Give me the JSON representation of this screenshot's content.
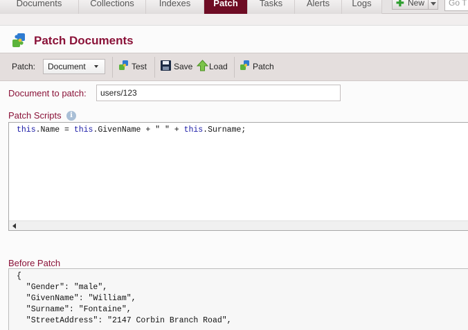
{
  "nav": {
    "tabs": [
      {
        "label": "Documents"
      },
      {
        "label": "Collections"
      },
      {
        "label": "Indexes"
      },
      {
        "label": "Patch"
      },
      {
        "label": "Tasks"
      },
      {
        "label": "Alerts"
      },
      {
        "label": "Logs"
      }
    ],
    "active_tab": "Patch",
    "new_button": "New",
    "goto_placeholder": "Go T"
  },
  "page": {
    "title": "Patch Documents"
  },
  "toolbar": {
    "patch_label": "Patch:",
    "patch_type": "Document",
    "test_label": "Test",
    "save_label": "Save",
    "load_label": "Load",
    "patch_button_label": "Patch"
  },
  "form": {
    "document_label": "Document to patch:",
    "document_value": "users/123",
    "scripts_label": "Patch Scripts",
    "script_parts": [
      "this",
      ".Name = ",
      "this",
      ".GivenName + \" \" + ",
      "this",
      ".Surname;"
    ],
    "before_label": "Before Patch",
    "before_lines": [
      "{",
      "  \"Gender\": \"male\",",
      "  \"GivenName\": \"William\",",
      "  \"Surname\": \"Fontaine\",",
      "  \"StreetAddress\": \"2147 Corbin Branch Road\","
    ]
  },
  "colors": {
    "accent": "#8a1238",
    "active_tab": "#6e0c24",
    "toolbar_bg": "#e4dedd",
    "keyword": "#1a1aa6"
  }
}
